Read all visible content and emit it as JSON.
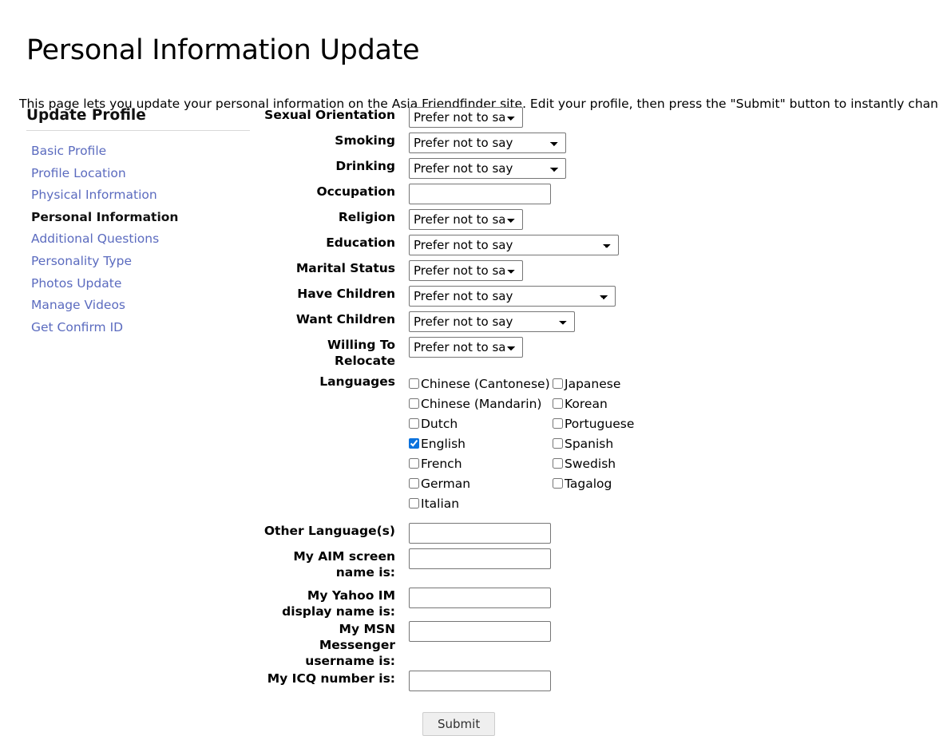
{
  "page": {
    "title": "Personal Information Update",
    "intro": "This page lets you update your personal information on the Asia Friendfinder site. Edit your profile, then press the \"Submit\" button to instantly change your data."
  },
  "sidebar": {
    "heading": "Update Profile",
    "items": [
      {
        "label": "Basic Profile",
        "active": false
      },
      {
        "label": "Profile Location",
        "active": false
      },
      {
        "label": "Physical Information",
        "active": false
      },
      {
        "label": "Personal Information",
        "active": true
      },
      {
        "label": "Additional Questions",
        "active": false
      },
      {
        "label": "Personality Type",
        "active": false
      },
      {
        "label": "Photos Update",
        "active": false
      },
      {
        "label": "Manage Videos",
        "active": false
      },
      {
        "label": "Get Confirm ID",
        "active": false
      }
    ]
  },
  "form": {
    "selects": {
      "sexual_orientation": {
        "label": "Sexual Orientation",
        "value": "Prefer not to say"
      },
      "smoking": {
        "label": "Smoking",
        "value": "Prefer not to say"
      },
      "drinking": {
        "label": "Drinking",
        "value": "Prefer not to say"
      },
      "religion": {
        "label": "Religion",
        "value": "Prefer not to say"
      },
      "education": {
        "label": "Education",
        "value": "Prefer not to say"
      },
      "marital_status": {
        "label": "Marital Status",
        "value": "Prefer not to say"
      },
      "have_children": {
        "label": "Have Children",
        "value": "Prefer not to say"
      },
      "want_children": {
        "label": "Want Children",
        "value": "Prefer not to say"
      },
      "willing_to_relocate": {
        "label": "Willing To Relocate",
        "value": "Prefer not to say"
      }
    },
    "text_fields": {
      "occupation": {
        "label": "Occupation",
        "value": ""
      },
      "other_languages": {
        "label": "Other Language(s)",
        "value": ""
      },
      "aim": {
        "label": "My AIM screen name is:",
        "value": ""
      },
      "yahoo": {
        "label": "My Yahoo IM display name is:",
        "value": ""
      },
      "msn": {
        "label": "My MSN Messenger username is:",
        "value": ""
      },
      "icq": {
        "label": "My ICQ number is:",
        "value": ""
      }
    },
    "languages": {
      "label": "Languages",
      "column_left": [
        {
          "label": "Chinese (Cantonese)",
          "checked": false
        },
        {
          "label": "Chinese (Mandarin)",
          "checked": false
        },
        {
          "label": "Dutch",
          "checked": false
        },
        {
          "label": "English",
          "checked": true
        },
        {
          "label": "French",
          "checked": false
        },
        {
          "label": "German",
          "checked": false
        },
        {
          "label": "Italian",
          "checked": false
        }
      ],
      "column_right": [
        {
          "label": "Japanese",
          "checked": false
        },
        {
          "label": "Korean",
          "checked": false
        },
        {
          "label": "Portuguese",
          "checked": false
        },
        {
          "label": "Spanish",
          "checked": false
        },
        {
          "label": "Swedish",
          "checked": false
        },
        {
          "label": "Tagalog",
          "checked": false
        }
      ]
    },
    "submit_label": "Submit"
  },
  "colors": {
    "link": "#5b6bbf",
    "checkbox_accent": "#0b72dd",
    "button_bg": "#efefef",
    "border": "#767676"
  }
}
